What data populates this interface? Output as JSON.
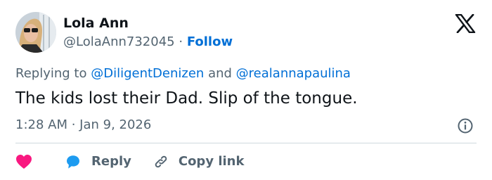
{
  "user": {
    "name": "Lola Ann",
    "handle": "@LolaAnn732045",
    "separator": "·",
    "follow_label": "Follow"
  },
  "reply": {
    "prefix": "Replying to",
    "mention_1": "@DiligentDenizen",
    "conjunction": "and",
    "mention_2": "@realannapaulina"
  },
  "tweet": {
    "text": "The kids lost their Dad. Slip of the tongue.",
    "timestamp": "1:28 AM · Jan 9, 2026"
  },
  "actions": {
    "reply_label": "Reply",
    "copy_link_label": "Copy link"
  },
  "icons": {
    "brand": "x-logo-icon",
    "info": "info-icon",
    "like": "heart-icon",
    "reply": "speech-bubble-icon",
    "copy": "link-icon"
  },
  "colors": {
    "link": "#006fd6",
    "secondary_text": "#536471",
    "heart": "#f91880",
    "reply_bubble": "#1d9bf0",
    "divider": "#cfd9de"
  }
}
